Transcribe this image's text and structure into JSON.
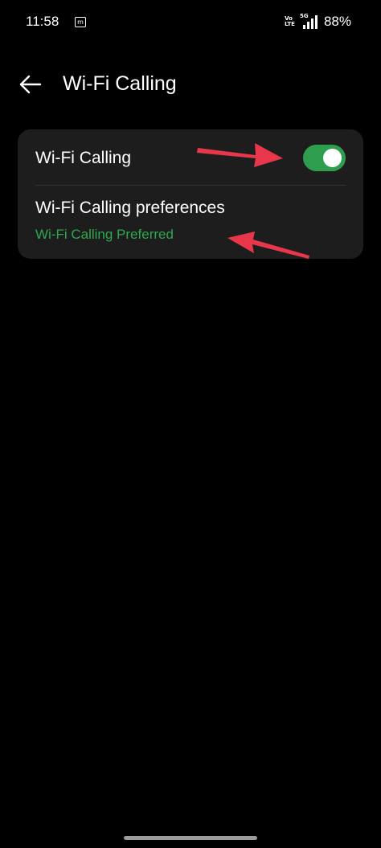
{
  "status_bar": {
    "time": "11:58",
    "notification_glyph": "m",
    "volte_top": "Vo",
    "volte_bottom": "LTE",
    "network": "5G",
    "battery": "88%"
  },
  "header": {
    "title": "Wi-Fi Calling",
    "back_icon": "back-arrow-icon"
  },
  "settings": {
    "wifi_calling": {
      "label": "Wi-Fi Calling",
      "enabled": true
    },
    "preferences": {
      "label": "Wi-Fi Calling preferences",
      "value": "Wi-Fi Calling Preferred"
    }
  },
  "colors": {
    "accent_green": "#2ea84f",
    "toggle_on": "#2e9e4e",
    "annotation_arrow": "#e8374a",
    "card_bg": "#1d1d1d"
  }
}
